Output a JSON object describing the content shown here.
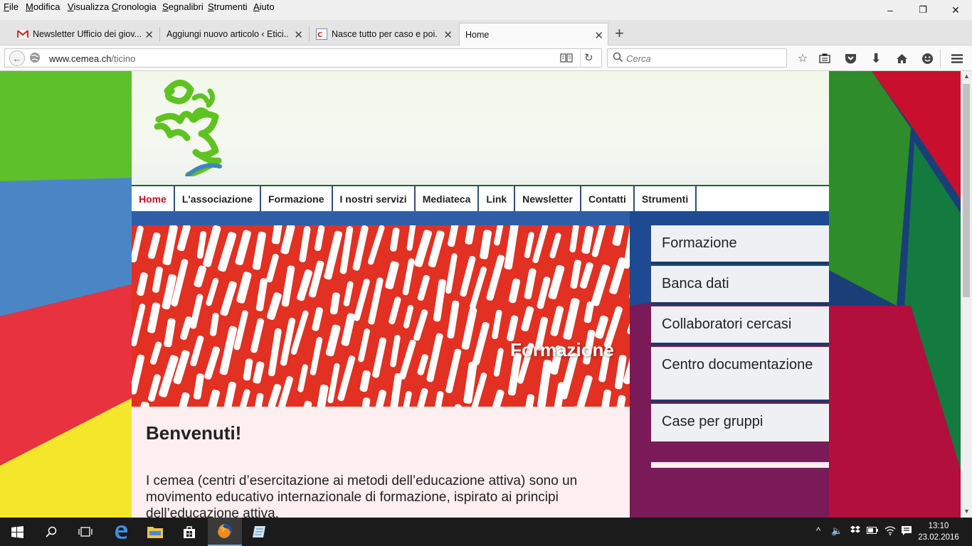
{
  "menubar": [
    "File",
    "Modifica",
    "Visualizza",
    "Cronologia",
    "Segnalibri",
    "Strumenti",
    "Aiuto"
  ],
  "window_controls": {
    "minimize": "–",
    "maximize": "❐",
    "close": "✕"
  },
  "tabs": [
    {
      "title": "Newsletter Ufficio dei giov...",
      "favicon": "gmail-icon"
    },
    {
      "title": "Aggiungi nuovo articolo ‹ Etici...",
      "favicon": "wordpress-icon"
    },
    {
      "title": "Nasce tutto per caso e poi...",
      "favicon": "site-icon"
    },
    {
      "title": "Home",
      "favicon": "none",
      "active": true
    }
  ],
  "new_tab_label": "+",
  "address": {
    "domain": "www.cemea.ch",
    "path": "/ticino"
  },
  "search": {
    "placeholder": "Cerca"
  },
  "site": {
    "nav": [
      "Home",
      "L'associazione",
      "Formazione",
      "I nostri servizi",
      "Mediateca",
      "Link",
      "Newsletter",
      "Contatti",
      "Strumenti"
    ],
    "hero_caption": "Formazione",
    "heading": "Benvenuti!",
    "intro": "I cemea (centri d’esercitazione ai metodi dell’educazione attiva) sono un movimento educativo internazionale di formazione, ispirato ai principi dell’educazione attiva.",
    "sidebar": [
      "Formazione",
      "Banca dati",
      "Collaboratori cercasi",
      "Centro documentazione",
      "Case per gruppi"
    ]
  },
  "taskbar": {
    "time": "13:10",
    "date": "23.02.2016"
  },
  "colors": {
    "nav_current": "#c8102e",
    "hero_red": "#e23022",
    "sidebar_border": "#1e3a66"
  }
}
